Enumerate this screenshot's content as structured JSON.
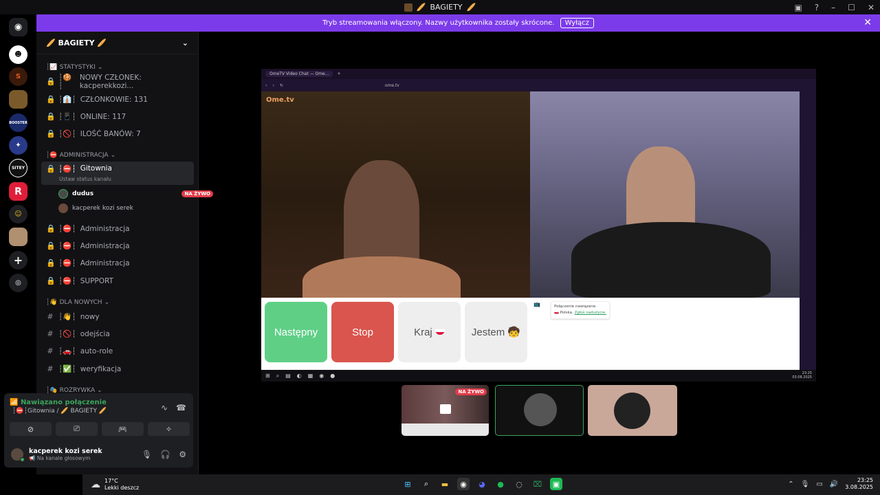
{
  "window": {
    "title": "BAGIETY",
    "title_emoji_left": "🥖",
    "title_emoji_right": "🥖"
  },
  "banner": {
    "text": "Tryb streamowania włączony. Nazwy użytkownika zostały skrócone.",
    "button": "Wyłącz"
  },
  "server": {
    "name": "BAGIETY",
    "emoji": "🥖"
  },
  "categories": {
    "stats": "STATYSTYKI",
    "admin": "ADMINISTRACJA",
    "new": "DLA NOWYCH",
    "fun": "ROZRYWKA"
  },
  "channels": {
    "stats": [
      "NOWY CZŁONEK: kacperekkozi...",
      "CZŁONKOWIE: 131",
      "ONLINE: 117",
      "ILOŚĆ BANÓW: 7"
    ],
    "active": {
      "name": "Gitownia",
      "status": "Ustaw status kanału"
    },
    "voice_users": [
      {
        "name": "dudus",
        "badge": "NA ŻYWO"
      },
      {
        "name": "kacperek kozi serek",
        "badge": ""
      }
    ],
    "admin": [
      "Administracja",
      "Administracja",
      "Administracja",
      "SUPPORT"
    ],
    "new": [
      "nowy",
      "odejścia",
      "auto-role",
      "weryfikacja"
    ]
  },
  "voice": {
    "status": "Nawiązano połączenie",
    "channel": "Gitownia / 🥖 BAGIETY 🥖"
  },
  "user": {
    "name": "kacperek kozi serek",
    "status": "Na kanale głosowym"
  },
  "stream": {
    "tab": "OmeTV Video Chat — Ome...",
    "url": "ome.tv",
    "logo": "Ome.tv",
    "buttons": {
      "next": "Następny",
      "stop": "Stop",
      "country": "Kraj",
      "gender": "Jestem"
    },
    "chat": {
      "line1": "Połączenie nawiązane.",
      "line2": "Polska.",
      "link": "Zgłoś nadużycie."
    },
    "clock": {
      "time": "23:25",
      "date": "03.08.2025"
    }
  },
  "thumb_badge": "NA ŻYWO",
  "taskbar": {
    "temp": "17°C",
    "weather": "Lekki deszcz",
    "time": "23:25",
    "date": "3.08.2025"
  },
  "colors": {
    "banner": "#7c3bea",
    "next": "#5fcf86",
    "stop": "#d9554e",
    "live": "#e23c4a",
    "connected": "#3ba55c"
  }
}
